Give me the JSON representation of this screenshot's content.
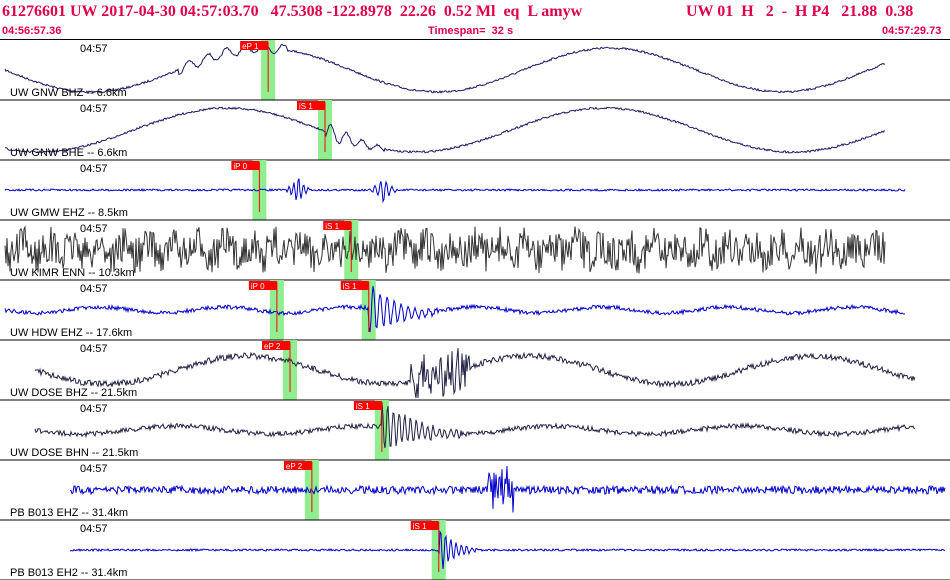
{
  "header": {
    "event_line": "61276601 UW 2017-04-30 04:57:03.70   47.5308 -122.8978  22.26  0.52 Ml  eq  L amyw",
    "event_line_right": "UW 01  H   2  -  H P4   21.88  0.38",
    "start_time": "04:56:57.36",
    "timespan": "Timespan=  32 s",
    "end_time": "04:57:29.73"
  },
  "colors": {
    "header_text": "#e0004a",
    "pick_fill": "#ff0000",
    "pick_window": "#90ee90",
    "trace_blue": "#0000cc",
    "trace_dark": "#222244",
    "trace_gray": "#333333"
  },
  "channels": [
    {
      "label": "UW GNW BHZ -- 6.6km",
      "time": "04:57",
      "color": "blue-dark",
      "style": "sine",
      "picks": [
        {
          "label": "eP 1",
          "pos": 0.295
        }
      ]
    },
    {
      "label": "UW GNW BHE -- 6.6km",
      "time": "04:57",
      "color": "blue-dark",
      "style": "sine2",
      "picks": [
        {
          "label": "iS 1",
          "pos": 0.36
        }
      ]
    },
    {
      "label": "UW GMW EHZ -- 8.5km",
      "time": "04:57",
      "color": "blue",
      "style": "quiet",
      "picks": [
        {
          "label": "iP 0",
          "pos": 0.285
        }
      ]
    },
    {
      "label": "UW KIMR ENN -- 10.3km",
      "time": "04:57",
      "color": "gray",
      "style": "noisy",
      "picks": [
        {
          "label": "iS 1",
          "pos": 0.39
        }
      ]
    },
    {
      "label": "UW HDW EHZ -- 17.6km",
      "time": "04:57",
      "color": "blue",
      "style": "event",
      "picks": [
        {
          "label": "iP 0",
          "pos": 0.305
        },
        {
          "label": "iS 1",
          "pos": 0.41
        }
      ]
    },
    {
      "label": "UW DOSE BHZ -- 21.5km",
      "time": "04:57",
      "color": "dark",
      "style": "wavy",
      "picks": [
        {
          "label": "eP 2",
          "pos": 0.32
        }
      ]
    },
    {
      "label": "UW DOSE BHN -- 21.5km",
      "time": "04:57",
      "color": "dark",
      "style": "wavy2",
      "picks": [
        {
          "label": "iS 1",
          "pos": 0.425
        }
      ]
    },
    {
      "label": "PB B013 EHZ -- 31.4km",
      "time": "04:57",
      "color": "blue",
      "style": "burst",
      "picks": [
        {
          "label": "eP 2",
          "pos": 0.345
        }
      ]
    },
    {
      "label": "PB B013 EH2 -- 31.4km",
      "time": "04:57",
      "color": "blue",
      "style": "burst2",
      "picks": [
        {
          "label": "iS 1",
          "pos": 0.49
        }
      ]
    }
  ]
}
